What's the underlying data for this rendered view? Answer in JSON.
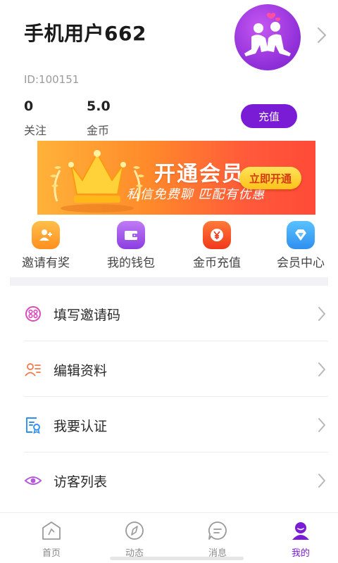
{
  "profile": {
    "username": "手机用户662",
    "id_text": "ID:100151",
    "following_count": "0",
    "following_label": "关注",
    "coins_count": "5.0",
    "coins_label": "金币",
    "recharge_label": "充值"
  },
  "banner": {
    "title": "开通会员",
    "subtitle": "私信免费聊 匹配有优惠",
    "button_label": "立即开通"
  },
  "quick_actions": [
    {
      "label": "邀请有奖",
      "icon": "invite-user-icon",
      "color": "#ff9d2a"
    },
    {
      "label": "我的钱包",
      "icon": "wallet-icon",
      "color": "#a25be8"
    },
    {
      "label": "金币充值",
      "icon": "coin-yen-icon",
      "color": "#ff5a2a"
    },
    {
      "label": "会员中心",
      "icon": "diamond-icon",
      "color": "#3aa8f5"
    }
  ],
  "menu": [
    {
      "label": "填写邀请码",
      "icon": "invite-code-icon"
    },
    {
      "label": "编辑资料",
      "icon": "edit-profile-icon"
    },
    {
      "label": "我要认证",
      "icon": "verify-document-icon"
    },
    {
      "label": "访客列表",
      "icon": "visitor-eye-icon"
    }
  ],
  "tabbar": [
    {
      "label": "首页",
      "icon": "home-icon",
      "active": false
    },
    {
      "label": "动态",
      "icon": "compass-icon",
      "active": false
    },
    {
      "label": "消息",
      "icon": "message-icon",
      "active": false
    },
    {
      "label": "我的",
      "icon": "profile-icon",
      "active": true
    }
  ],
  "colors": {
    "accent": "#7a1cd6",
    "banner_start": "#ffb23a",
    "banner_end": "#ff4a38"
  }
}
